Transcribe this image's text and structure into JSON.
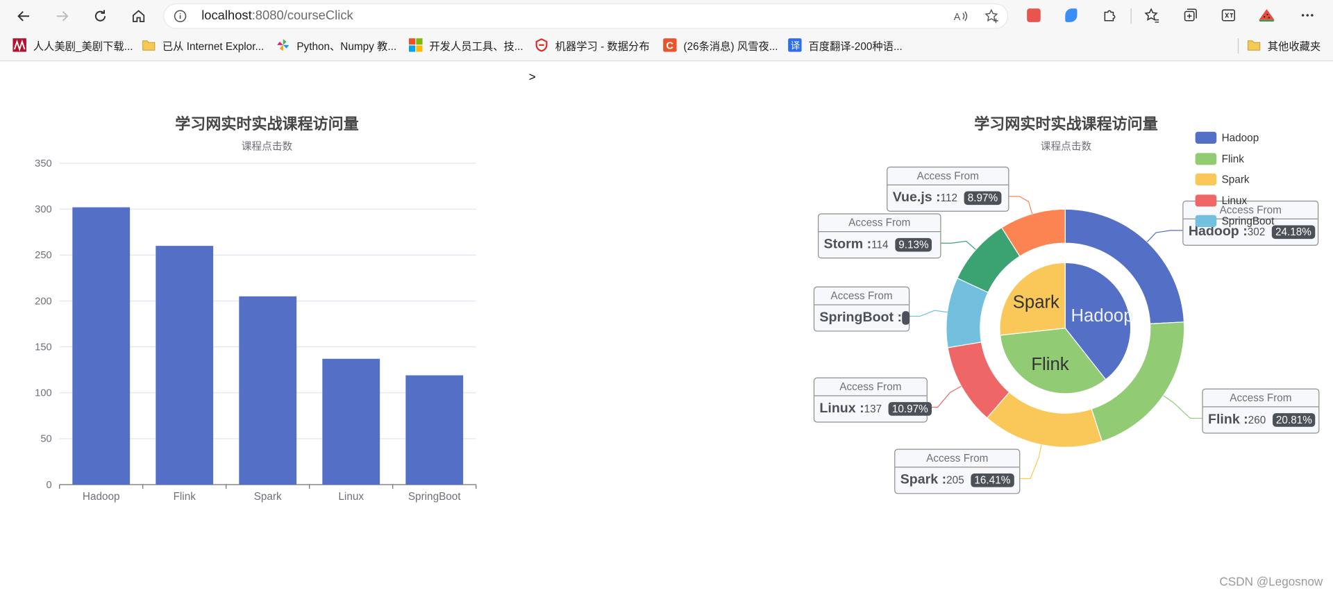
{
  "browser": {
    "url_host": "localhost",
    "url_path": ":8080/courseClick",
    "bookmarks": [
      {
        "label": "人人美剧_美剧下载...",
        "icon": "renren-icon",
        "color": "#c8102e"
      },
      {
        "label": "已从 Internet Explor...",
        "icon": "folder-icon",
        "color": "#e9b949"
      },
      {
        "label": "Python、Numpy 教...",
        "icon": "pinwheel-icon",
        "color": "#6aa84f"
      },
      {
        "label": "开发人员工具、技...",
        "icon": "microsoft-icon",
        "color": "#00a4ef"
      },
      {
        "label": "机器学习 - 数据分布",
        "icon": "shield-logo-icon",
        "color": "#d32f2f"
      },
      {
        "label": "(26条消息) 风雪夜...",
        "icon": "csdn-icon",
        "color": "#e8552d"
      },
      {
        "label": "百度翻译-200种语...",
        "icon": "translate-icon",
        "color": "#2d6ee8"
      }
    ],
    "other_bookmarks": "其他收藏夹"
  },
  "page": {
    "stray_text": ">",
    "watermark": "CSDN @Legosnow"
  },
  "bar_chart": {
    "title": "学习网实时实战课程访问量",
    "subtitle": "课程点击数"
  },
  "pie_chart": {
    "title": "学习网实时实战课程访问量",
    "subtitle": "课程点击数",
    "callout_header": "Access From"
  },
  "colors": {
    "Hadoop": "#5470c6",
    "Flink": "#91cc75",
    "Spark": "#fac858",
    "Linux": "#ee6666",
    "SpringBoot": "#73c0de",
    "Storm": "#3ba272",
    "Vue.js": "#fc8452"
  },
  "chart_data": [
    {
      "type": "bar",
      "title": "学习网实时实战课程访问量",
      "subtitle": "课程点击数",
      "categories": [
        "Hadoop",
        "Flink",
        "Spark",
        "Linux",
        "SpringBoot"
      ],
      "values": [
        302,
        260,
        205,
        137,
        119
      ],
      "ylim": [
        0,
        350
      ],
      "yticks": [
        0,
        50,
        100,
        150,
        200,
        250,
        300,
        350
      ],
      "grid": true
    },
    {
      "type": "pie",
      "title": "学习网实时实战课程访问量",
      "subtitle": "课程点击数",
      "legend": [
        "Hadoop",
        "Flink",
        "Spark",
        "Linux",
        "SpringBoot"
      ],
      "legend_position": "top-right",
      "inner": [
        {
          "name": "Hadoop",
          "value": 302
        },
        {
          "name": "Flink",
          "value": 260
        },
        {
          "name": "Spark",
          "value": 205
        }
      ],
      "outer": [
        {
          "name": "Hadoop",
          "value": 302,
          "percent": "24.18%"
        },
        {
          "name": "Flink",
          "value": 260,
          "percent": "20.81%"
        },
        {
          "name": "Spark",
          "value": 205,
          "percent": "16.41%"
        },
        {
          "name": "Linux",
          "value": 137,
          "percent": "10.97%"
        },
        {
          "name": "SpringBoot",
          "value": 119,
          "percent": ""
        },
        {
          "name": "Storm",
          "value": 114,
          "percent": "9.13%"
        },
        {
          "name": "Vue.js",
          "value": 112,
          "percent": "8.97%"
        }
      ]
    }
  ]
}
